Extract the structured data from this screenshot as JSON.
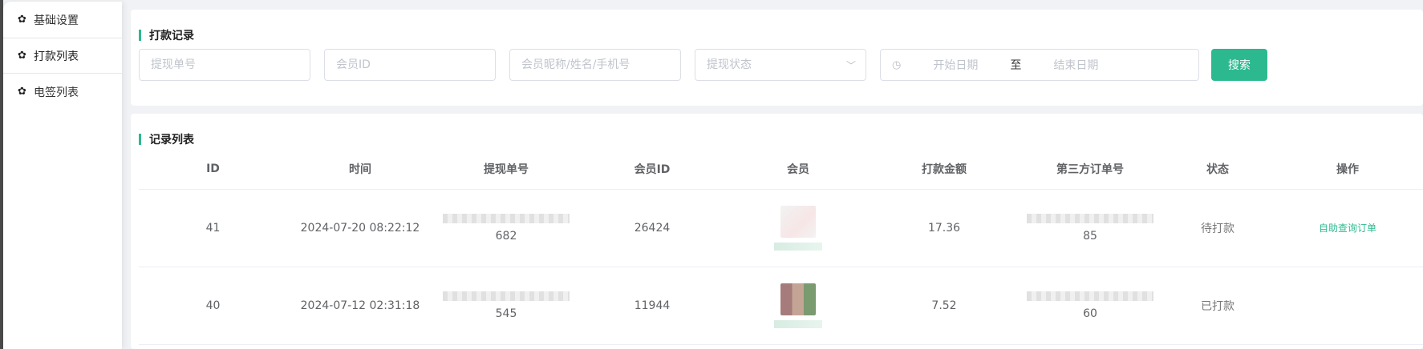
{
  "sidebar": {
    "items": [
      {
        "label": "基础设置",
        "icon": "gear-icon"
      },
      {
        "label": "打款列表",
        "icon": "gear-icon"
      },
      {
        "label": "电签列表",
        "icon": "gear-icon"
      }
    ]
  },
  "search_card": {
    "title": "打款记录",
    "withdraw_no_placeholder": "提现单号",
    "member_id_placeholder": "会员ID",
    "member_name_placeholder": "会员昵称/姓名/手机号",
    "status_placeholder": "提现状态",
    "start_date_placeholder": "开始日期",
    "date_separator": "至",
    "end_date_placeholder": "结束日期",
    "search_label": "搜索"
  },
  "records_card": {
    "title": "记录列表",
    "columns": [
      "ID",
      "时间",
      "提现单号",
      "会员ID",
      "会员",
      "打款金额",
      "第三方订单号",
      "状态",
      "操作"
    ],
    "rows": [
      {
        "id": "41",
        "time": "2024-07-20 08:22:12",
        "withdraw_no_tail": "682",
        "member_id": "26424",
        "amount": "17.36",
        "third_party_tail": "85",
        "status": "待打款",
        "action": "自助查询订单"
      },
      {
        "id": "40",
        "time": "2024-07-12 02:31:18",
        "withdraw_no_tail": "545",
        "member_id": "11944",
        "amount": "7.52",
        "third_party_tail": "60",
        "status": "已打款",
        "action": ""
      }
    ]
  },
  "colors": {
    "accent": "#2cb98f",
    "background": "#f0f2f5"
  }
}
